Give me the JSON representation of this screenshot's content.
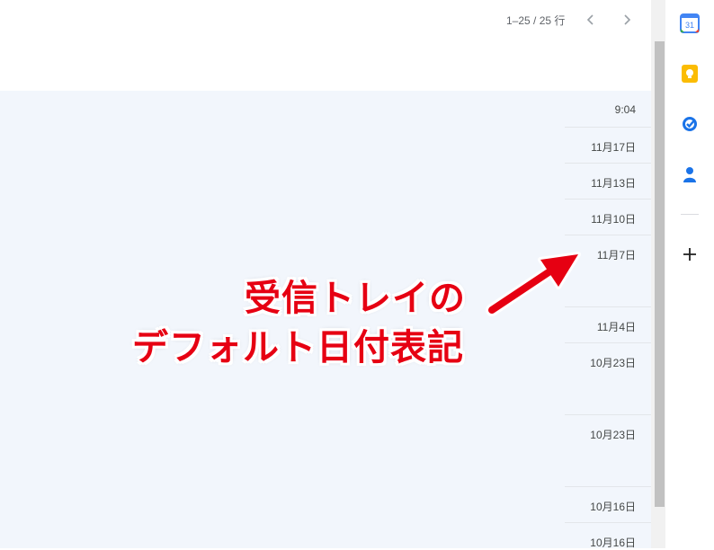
{
  "toolbar": {
    "range": "1–25 / 25 行",
    "prev_icon": "chevron-left-icon",
    "next_icon": "chevron-right-icon"
  },
  "mail_dates": [
    "9:04",
    "11月17日",
    "11月13日",
    "11月10日",
    "11月7日",
    "11月4日",
    "10月23日",
    "10月23日",
    "10月16日",
    "10月16日"
  ],
  "side_panel": {
    "calendar_label": "31",
    "icons": [
      "calendar-icon",
      "keep-icon",
      "tasks-icon",
      "contacts-icon",
      "add-icon"
    ]
  },
  "annotation": {
    "line1": "受信トレイの",
    "line2": "デフォルト日付表記",
    "color": "#e60012"
  }
}
